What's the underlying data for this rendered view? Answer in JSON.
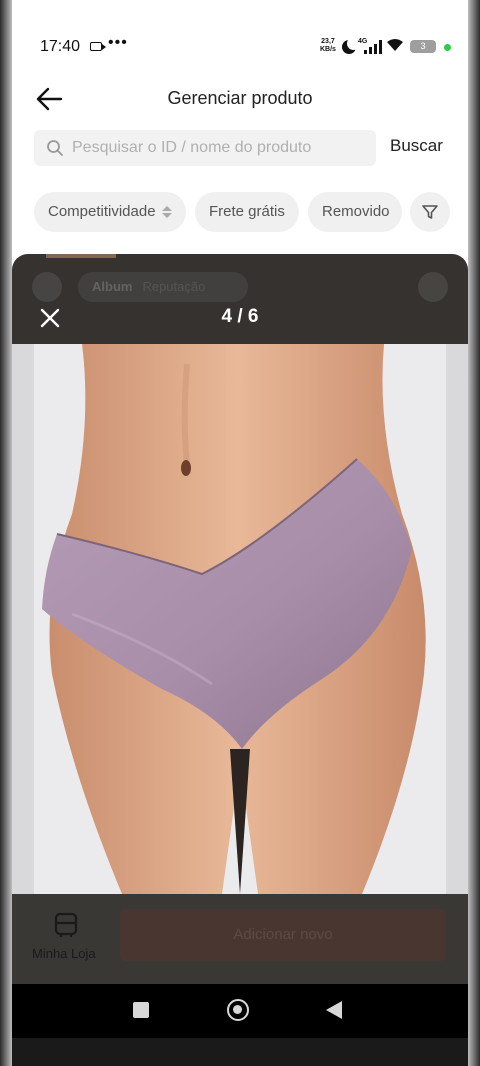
{
  "status_bar": {
    "time": "17:40",
    "dots": "•••",
    "net_speed_value": "23,7",
    "net_speed_unit": "KB/s",
    "network": "4G",
    "battery": "3"
  },
  "header": {
    "title": "Gerenciar produto",
    "back_icon": "back-arrow-icon"
  },
  "search": {
    "placeholder": "Pesquisar o ID / nome do produto",
    "button": "Buscar"
  },
  "filters": {
    "chips": [
      "Competitividade",
      "Frete grátis",
      "Removido"
    ]
  },
  "viewer": {
    "counter": "4 / 6",
    "behind_tab_1": "Album",
    "behind_tab_2": "Reputação"
  },
  "bottom_bar": {
    "store_label": "Minha Loja",
    "action_button": "Adicionar novo"
  },
  "colors": {
    "overlay": "#282522",
    "product": "#a88ea8",
    "accent_online": "#2ecc40"
  }
}
